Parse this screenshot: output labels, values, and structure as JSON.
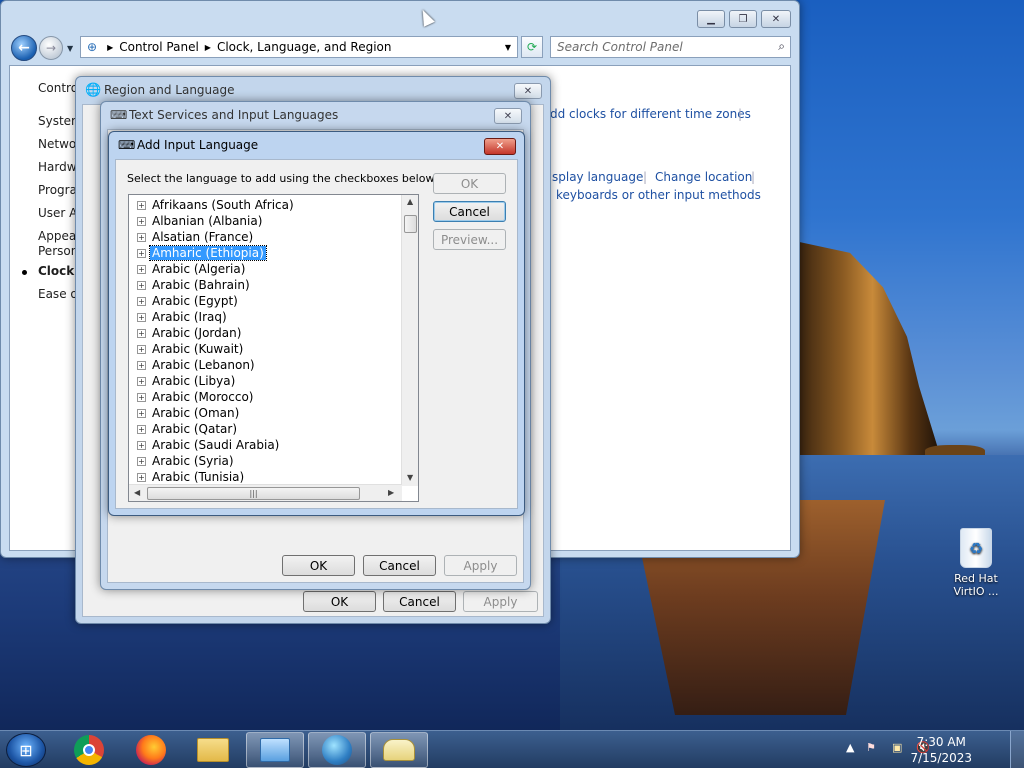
{
  "control_panel": {
    "breadcrumb": [
      "Control Panel",
      "Clock, Language, and Region"
    ],
    "search_placeholder": "Search Control Panel",
    "sidebar": [
      {
        "label": "Contro"
      },
      {
        "label": "System"
      },
      {
        "label": "Networ"
      },
      {
        "label": "Hardwa"
      },
      {
        "label": "Progra"
      },
      {
        "label": "User Ac"
      },
      {
        "label": "Appear"
      },
      {
        "label": "Persona"
      },
      {
        "label": "Clock, l"
      },
      {
        "label": "Ease of"
      }
    ],
    "links": {
      "clocks": "dd clocks for different time zones",
      "display_language": "splay language",
      "change_location": "Change location",
      "keyboards": "keyboards or other input methods"
    }
  },
  "region_dialog": {
    "title": "Region and Language",
    "ok": "OK",
    "cancel": "Cancel",
    "apply": "Apply"
  },
  "text_services_dialog": {
    "title": "Text Services and Input Languages",
    "ok": "OK",
    "cancel": "Cancel",
    "apply": "Apply"
  },
  "add_input_dialog": {
    "title": "Add Input Language",
    "instruction": "Select the language to add using the checkboxes below.",
    "ok": "OK",
    "cancel": "Cancel",
    "preview": "Preview...",
    "languages": [
      "Afrikaans (South Africa)",
      "Albanian (Albania)",
      "Alsatian (France)",
      "Amharic (Ethiopia)",
      "Arabic (Algeria)",
      "Arabic (Bahrain)",
      "Arabic (Egypt)",
      "Arabic (Iraq)",
      "Arabic (Jordan)",
      "Arabic (Kuwait)",
      "Arabic (Lebanon)",
      "Arabic (Libya)",
      "Arabic (Morocco)",
      "Arabic (Oman)",
      "Arabic (Qatar)",
      "Arabic (Saudi Arabia)",
      "Arabic (Syria)",
      "Arabic (Tunisia)"
    ],
    "selected_index": 3
  },
  "desktop": {
    "recycle_bin_label": "Red Hat VirtIO ..."
  },
  "taskbar": {
    "time": "7:30 AM",
    "date": "7/15/2023"
  }
}
